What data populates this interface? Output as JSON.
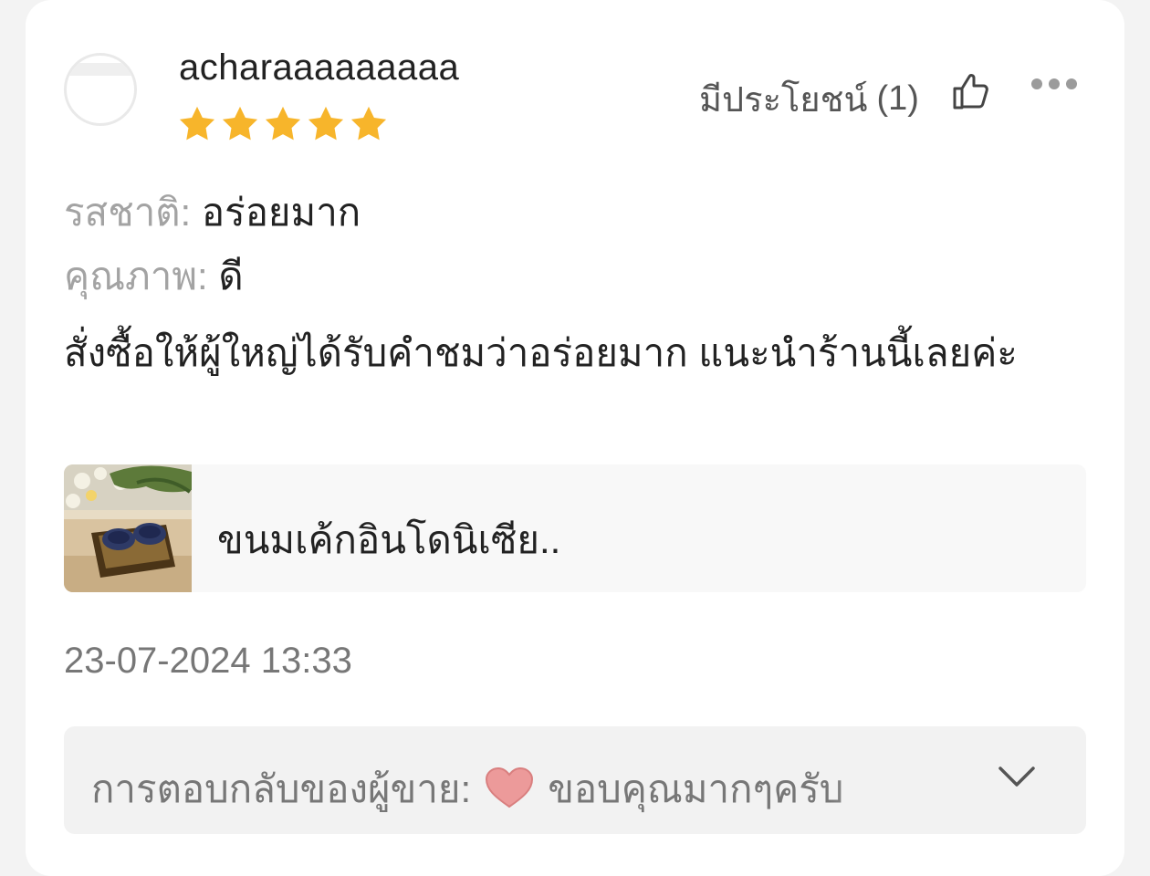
{
  "review": {
    "username": "acharaaaaaaaaa",
    "rating": 5,
    "rating_max": 5,
    "helpful_label": "มีประโยชน์",
    "helpful_count": "(1)",
    "taste_label": "รสชาติ:",
    "taste_value": "อร่อยมาก",
    "quality_label": "คุณภาพ:",
    "quality_value": "ดี",
    "body": "สั่งซื้อให้ผู้ใหญ่ได้รับคำชมว่าอร่อยมาก แนะนำร้านนี้เลยค่ะ",
    "product_name": "ขนมเค้กอินโดนิเซีย..",
    "date": "23-07-2024 13:33",
    "seller_reply_label": "การตอบกลับของผู้ขาย:",
    "seller_reply_text": "ขอบคุณมากๆครับ"
  },
  "colors": {
    "star": "#f7b52b",
    "label_gray": "#a3a3a3",
    "reply_bg": "#f2f2f2"
  },
  "icons": {
    "thumb": "thumbs-up-icon",
    "more": "more-dots-icon",
    "heart": "heart-icon",
    "chevron": "chevron-down-icon"
  }
}
